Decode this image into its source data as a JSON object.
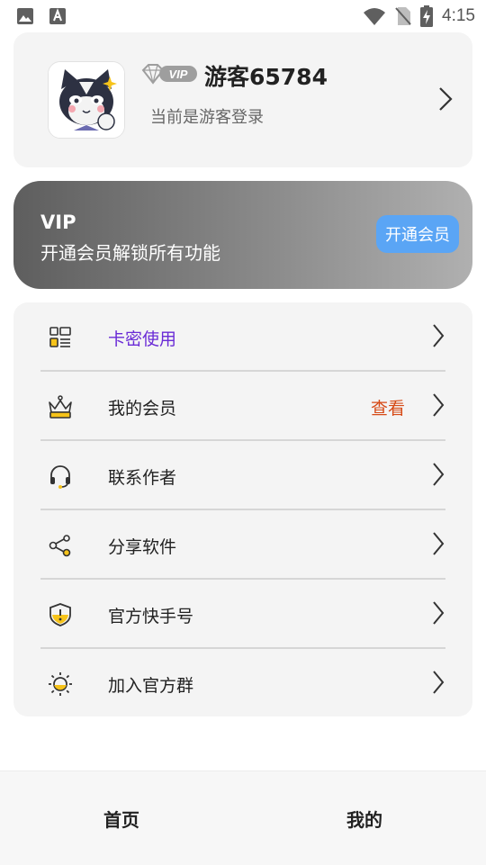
{
  "status_bar": {
    "time": "4:15",
    "left_icons": [
      "image-icon",
      "font-icon"
    ],
    "right_icons": [
      "wifi-icon",
      "no-sim-icon",
      "battery-charging-icon"
    ]
  },
  "profile": {
    "vip_badge": "VIP",
    "username": "游客65784",
    "login_state": "当前是游客登录",
    "arrow_icon": "chevron-right-icon"
  },
  "vip_banner": {
    "title": "VIP",
    "subtitle": "开通会员解锁所有功能",
    "button_label": "开通会员"
  },
  "menu": {
    "items": [
      {
        "label": "卡密使用",
        "icon": "card-code-icon",
        "accent": true,
        "extra": ""
      },
      {
        "label": "我的会员",
        "icon": "crown-icon",
        "accent": false,
        "extra": "查看"
      },
      {
        "label": "联系作者",
        "icon": "headset-icon",
        "accent": false,
        "extra": ""
      },
      {
        "label": "分享软件",
        "icon": "share-icon",
        "accent": false,
        "extra": ""
      },
      {
        "label": "官方快手号",
        "icon": "shield-alert-icon",
        "accent": false,
        "extra": ""
      },
      {
        "label": "加入官方群",
        "icon": "sun-group-icon",
        "accent": false,
        "extra": ""
      }
    ]
  },
  "bottom_nav": {
    "tabs": [
      {
        "label": "首页"
      },
      {
        "label": "我的"
      }
    ]
  },
  "colors": {
    "accent_purple": "#6a2bd6",
    "extra_orange": "#d64a16",
    "vip_button": "#5aa5f5",
    "icon_yellow": "#f6c31a",
    "card_bg": "#f4f4f4"
  }
}
